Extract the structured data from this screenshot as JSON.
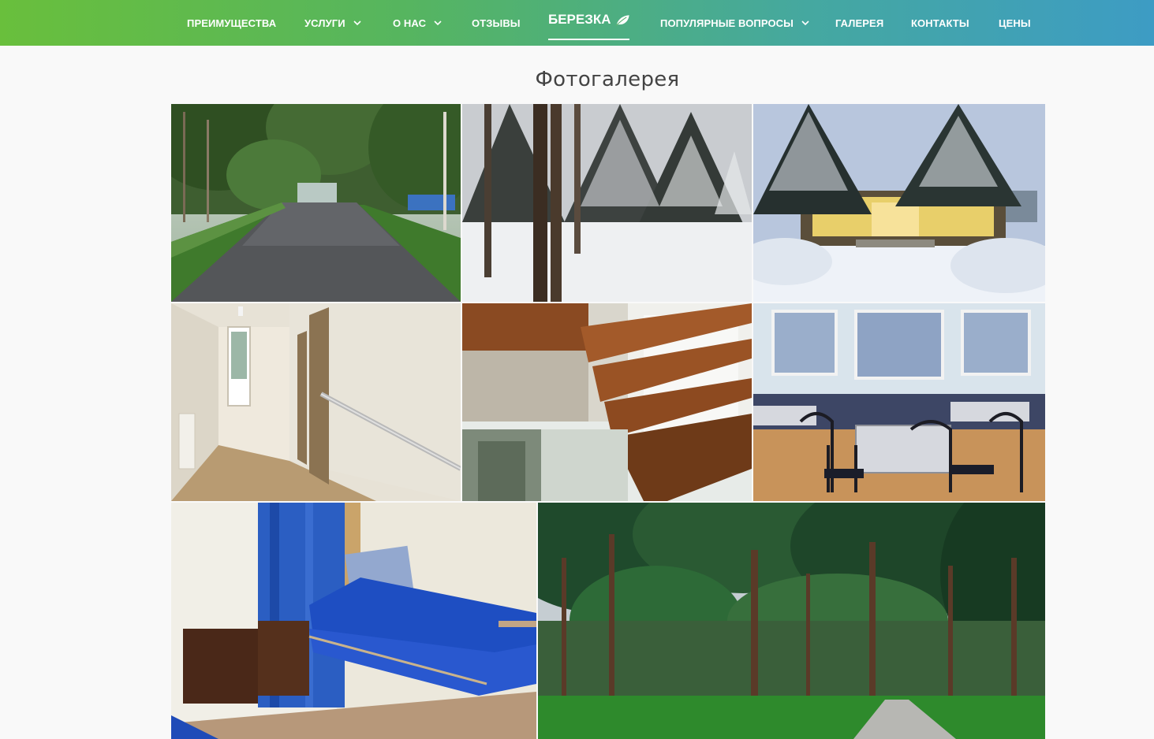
{
  "nav": {
    "items": [
      {
        "label": "ПРЕИМУЩЕСТВА"
      },
      {
        "label": "УСЛУГИ",
        "dropdown": true
      },
      {
        "label": "О НАС",
        "dropdown": true
      },
      {
        "label": "ОТЗЫВЫ"
      },
      {
        "label": "ПОПУЛЯРНЫЕ ВОПРОСЫ",
        "dropdown": true
      },
      {
        "label": "ГАЛЕРЕЯ"
      },
      {
        "label": "КОНТАКТЫ"
      },
      {
        "label": "ЦЕНЫ"
      }
    ],
    "brand": "БЕРЕЗКА",
    "brand_icon": "leaf-icon",
    "gradient": [
      "#69bf3c",
      "#3d9cc4"
    ]
  },
  "gallery": {
    "title": "Фотогалерея",
    "photos": [
      {
        "subject": "summer-alley"
      },
      {
        "subject": "winter-fir-forest"
      },
      {
        "subject": "winter-building-entrance"
      },
      {
        "subject": "corridor-with-handrail"
      },
      {
        "subject": "wooden-staircase"
      },
      {
        "subject": "dining-hall"
      },
      {
        "subject": "bedroom-with-blue-bed"
      },
      {
        "subject": "pine-forest-path"
      }
    ]
  }
}
